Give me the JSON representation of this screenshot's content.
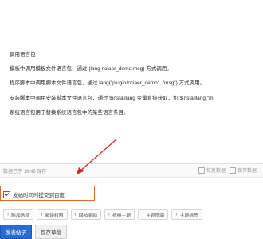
{
  "editor": {
    "lines": [
      "调用语言包",
      "模板中调用模板文件语言包，通过 {lang nciaer_demo:msg} 方式调用。",
      "程序脚本中调用脚本文件语言包，通过 lang(\"plugin/nciaer_demo\", \"msg\") 方式调用。",
      "安装脚本中调用安装脚本文件语言包，通过 $installlang 变量直接获取，如 $installlang[\"m",
      "系统语言包用于替换系统语言包中的某些语言条目。"
    ]
  },
  "status": {
    "saved_text": "数据已于 16:48 保存",
    "save_data_label": "保存数据",
    "restore_label": "恢复数据"
  },
  "options": {
    "sync_label": "发帖时同时提交到百度",
    "checked": true
  },
  "toolbar": {
    "buttons": [
      {
        "label": "附加选项",
        "icon": "plus-icon"
      },
      {
        "label": "阅读权限",
        "icon": "plus-icon"
      },
      {
        "label": "回帖奖励",
        "icon": "plus-icon"
      },
      {
        "label": "抢楼主题",
        "icon": "plus-icon"
      },
      {
        "label": "主题图章",
        "icon": "plus-icon"
      },
      {
        "label": "主题标签",
        "icon": "plus-icon"
      }
    ]
  },
  "actions": {
    "submit_label": "发表帖子",
    "draft_label": "保存草稿"
  },
  "colors": {
    "accent_border": "#e06b2b",
    "arrow": "#d9262a",
    "primary_button": "#2a6bd3"
  }
}
